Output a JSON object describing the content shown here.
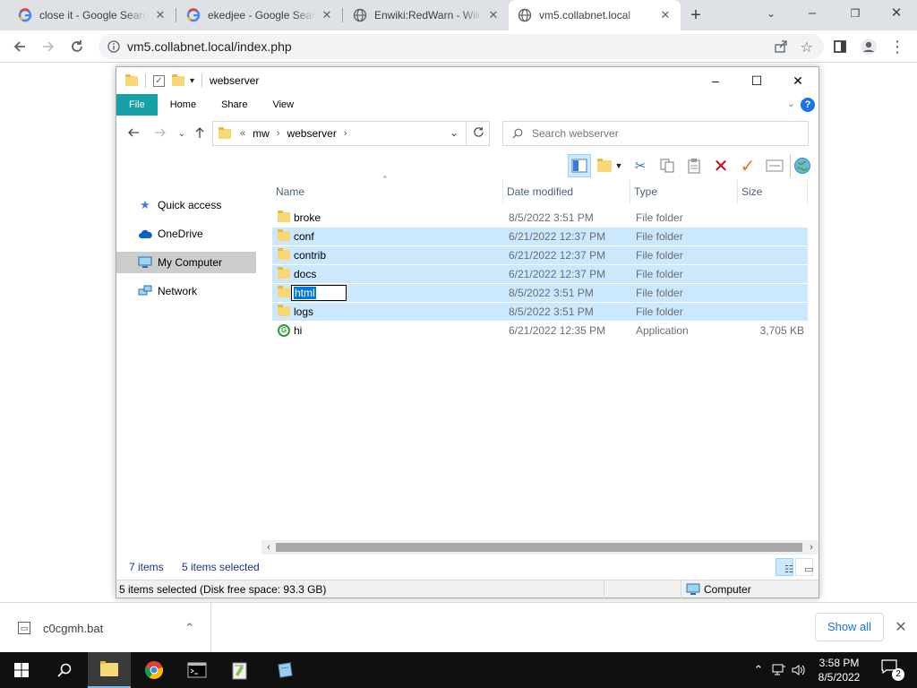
{
  "browser": {
    "tabs": [
      {
        "label": "close it - Google Search",
        "icon": "google-icon"
      },
      {
        "label": "ekedjee - Google Search",
        "icon": "google-icon"
      },
      {
        "label": "Enwiki:RedWarn - Wikipedia",
        "icon": "globe-icon"
      },
      {
        "label": "vm5.collabnet.local",
        "icon": "globe-icon",
        "active": true
      }
    ],
    "url": "vm5.collabnet.local/index.php"
  },
  "explorer": {
    "title": "webserver",
    "ribbon_tabs": [
      "File",
      "Home",
      "Share",
      "View"
    ],
    "breadcrumb": [
      "mw",
      "webserver"
    ],
    "breadcrumb_prefix": "«",
    "search_placeholder": "Search webserver",
    "nav": [
      "Quick access",
      "OneDrive",
      "My Computer",
      "Network"
    ],
    "columns": [
      "Name",
      "Date modified",
      "Type",
      "Size"
    ],
    "files": [
      {
        "name": "broke",
        "date": "8/5/2022 3:51 PM",
        "type": "File folder",
        "size": "",
        "selected": false
      },
      {
        "name": "conf",
        "date": "6/21/2022 12:37 PM",
        "type": "File folder",
        "size": "",
        "selected": true
      },
      {
        "name": "contrib",
        "date": "6/21/2022 12:37 PM",
        "type": "File folder",
        "size": "",
        "selected": true
      },
      {
        "name": "docs",
        "date": "6/21/2022 12:37 PM",
        "type": "File folder",
        "size": "",
        "selected": true
      },
      {
        "name": "html",
        "date": "8/5/2022 3:51 PM",
        "type": "File folder",
        "size": "",
        "selected": true,
        "renaming": true
      },
      {
        "name": "logs",
        "date": "8/5/2022 3:51 PM",
        "type": "File folder",
        "size": "",
        "selected": true
      },
      {
        "name": "hi",
        "date": "6/21/2022 12:35 PM",
        "type": "Application",
        "size": "3,705 KB",
        "selected": false
      }
    ],
    "status_items": "7 items",
    "status_selected": "5 items selected",
    "status_bar": "5 items selected (Disk free space: 93.3 GB)",
    "status_location": "Computer",
    "colors": {
      "file_tab": "#17a0a6",
      "selection": "#cce8ff",
      "status_text": "#1e3287"
    }
  },
  "downloads": {
    "file": "c0cgmh.bat",
    "show_all": "Show all"
  },
  "taskbar": {
    "time": "3:58 PM",
    "date": "8/5/2022",
    "notifications": "2"
  }
}
